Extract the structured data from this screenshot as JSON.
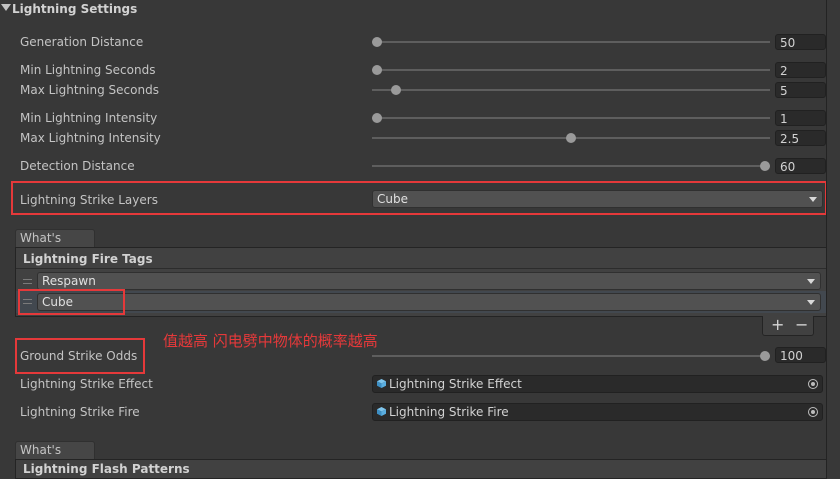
{
  "section": {
    "title": "Lightning Settings"
  },
  "fields": {
    "generation_distance": {
      "label": "Generation Distance",
      "value": "50",
      "fraction": 0.0
    },
    "min_lightning_seconds": {
      "label": "Min Lightning Seconds",
      "value": "2",
      "fraction": 0.0
    },
    "max_lightning_seconds": {
      "label": "Max Lightning Seconds",
      "value": "5",
      "fraction": 0.05
    },
    "min_lightning_intensity": {
      "label": "Min Lightning Intensity",
      "value": "1",
      "fraction": 0.0
    },
    "max_lightning_intensity": {
      "label": "Max Lightning Intensity",
      "value": "2.5",
      "fraction": 0.5
    },
    "detection_distance": {
      "label": "Detection Distance",
      "value": "60",
      "fraction": 1.0
    },
    "strike_layers": {
      "label": "Lightning Strike Layers",
      "value": "Cube"
    },
    "ground_strike_odds": {
      "label": "Ground Strike Odds",
      "value": "100",
      "fraction": 1.0
    },
    "strike_effect": {
      "label": "Lightning Strike Effect",
      "value": "Lightning Strike Effect"
    },
    "strike_fire": {
      "label": "Lightning Strike Fire",
      "value": "Lightning Strike Fire"
    }
  },
  "fire_tags": {
    "help_label": "What's This?",
    "title": "Lightning Fire Tags",
    "items": [
      "Respawn",
      "Cube"
    ],
    "add_label": "+",
    "remove_label": "−"
  },
  "annotation": {
    "text": "值越高 闪电劈中物体的概率越高",
    "color": "#e5393a"
  },
  "flash": {
    "help_label": "What's This?",
    "title": "Lightning Flash Patterns"
  },
  "icons": {
    "dropdown": "chevron-down-icon",
    "object": "prefab-cube-icon",
    "picker": "object-picker-icon",
    "handle": "drag-handle-icon"
  }
}
